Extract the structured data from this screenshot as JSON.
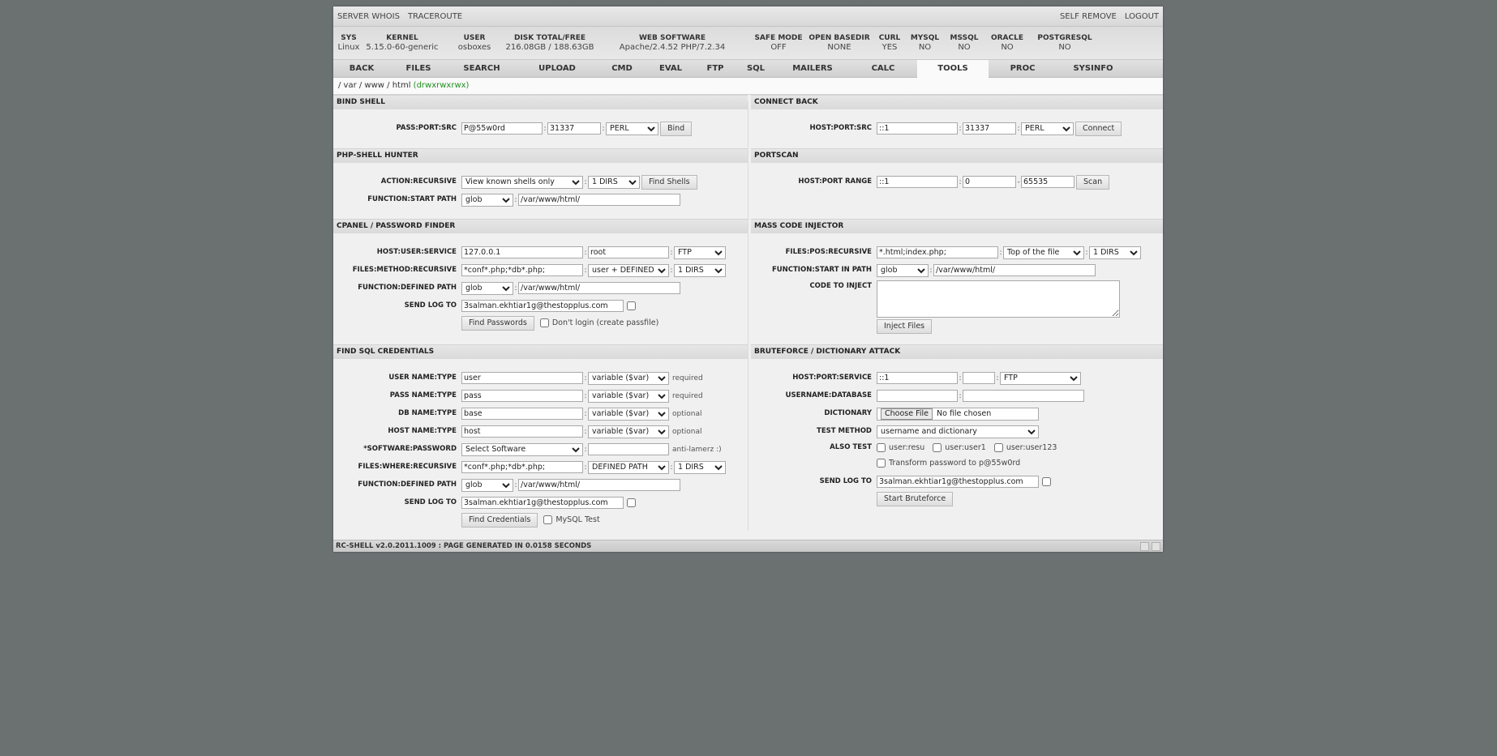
{
  "topbar": {
    "left": [
      "SERVER WHOIS",
      "TRACEROUTE"
    ],
    "right": [
      "SELF REMOVE",
      "LOGOUT"
    ]
  },
  "info": [
    {
      "h": "SYS",
      "v": "Linux"
    },
    {
      "h": "KERNEL",
      "v": "5.15.0-60-generic"
    },
    {
      "h": "USER",
      "v": "osboxes"
    },
    {
      "h": "DISK TOTAL/FREE",
      "v": "216.08GB / 188.63GB"
    },
    {
      "h": "WEB SOFTWARE",
      "v": "Apache/2.4.52 PHP/7.2.34"
    },
    {
      "h": "SAFE MODE",
      "v": "OFF"
    },
    {
      "h": "OPEN BASEDIR",
      "v": "NONE"
    },
    {
      "h": "CURL",
      "v": "YES"
    },
    {
      "h": "MYSQL",
      "v": "NO"
    },
    {
      "h": "MSSQL",
      "v": "NO"
    },
    {
      "h": "ORACLE",
      "v": "NO"
    },
    {
      "h": "POSTGRESQL",
      "v": "NO"
    }
  ],
  "tabs": [
    "BACK",
    "FILES",
    "SEARCH",
    "UPLOAD",
    "CMD",
    "EVAL",
    "FTP",
    "SQL",
    "MAILERS",
    "CALC",
    "TOOLS",
    "PROC",
    "SYSINFO"
  ],
  "active_tab": "TOOLS",
  "path": {
    "text": "/ var / www / html",
    "perm": "(drwxrwxrwx)"
  },
  "bind_shell": {
    "title": "BIND SHELL",
    "label": "PASS:PORT:SRC",
    "pass": "P@55w0rd",
    "port": "31337",
    "src": "PERL",
    "button": "Bind"
  },
  "connect_back": {
    "title": "CONNECT BACK",
    "label": "HOST:PORT:SRC",
    "host": "::1",
    "port": "31337",
    "src": "PERL",
    "button": "Connect"
  },
  "hunter": {
    "title": "PHP-SHELL HUNTER",
    "label1": "ACTION:RECURSIVE",
    "action": "View known shells only",
    "recursive": "1 DIRS",
    "button": "Find Shells",
    "label2": "FUNCTION:START PATH",
    "function": "glob",
    "path": "/var/www/html/"
  },
  "portscan": {
    "title": "PORTSCAN",
    "label": "HOST:PORT RANGE",
    "host": "::1",
    "from": "0",
    "to": "65535",
    "button": "Scan"
  },
  "cpanel": {
    "title": "CPANEL / PASSWORD FINDER",
    "label1": "HOST:USER:SERVICE",
    "host": "127.0.0.1",
    "user": "root",
    "service": "FTP",
    "label2": "FILES:METHOD:RECURSIVE",
    "files": "*conf*.php;*db*.php;",
    "method": "user + DEFINED",
    "recursive": "1 DIRS",
    "label3": "FUNCTION:DEFINED PATH",
    "function": "glob",
    "path": "/var/www/html/",
    "label4": "SEND LOG TO",
    "log": "3salman.ekhtiar1g@thestopplus.com",
    "button": "Find Passwords",
    "check": "Don't login (create passfile)"
  },
  "mass": {
    "title": "MASS CODE INJECTOR",
    "label1": "FILES:POS:RECURSIVE",
    "files": "*.html;index.php;",
    "pos": "Top of the file",
    "recursive": "1 DIRS",
    "label2": "FUNCTION:START IN PATH",
    "function": "glob",
    "path": "/var/www/html/",
    "label3": "CODE TO INJECT",
    "button": "Inject Files"
  },
  "sql": {
    "title": "FIND SQL CREDENTIALS",
    "rows": [
      {
        "label": "USER NAME:TYPE",
        "value": "user",
        "type": "variable ($var)",
        "note": "required"
      },
      {
        "label": "PASS NAME:TYPE",
        "value": "pass",
        "type": "variable ($var)",
        "note": "required"
      },
      {
        "label": "DB NAME:TYPE",
        "value": "base",
        "type": "variable ($var)",
        "note": "optional"
      },
      {
        "label": "HOST NAME:TYPE",
        "value": "host",
        "type": "variable ($var)",
        "note": "optional"
      }
    ],
    "label5": "*SOFTWARE:PASSWORD",
    "software": "Select Software",
    "password": "",
    "note5": "anti-lamerz :)",
    "label6": "FILES:WHERE:RECURSIVE",
    "files": "*conf*.php;*db*.php;",
    "where": "DEFINED PATH",
    "recursive": "1 DIRS",
    "label7": "FUNCTION:DEFINED PATH",
    "function": "glob",
    "path": "/var/www/html/",
    "label8": "SEND LOG TO",
    "log": "3salman.ekhtiar1g@thestopplus.com",
    "button": "Find Credentials",
    "check": "MySQL Test"
  },
  "brute": {
    "title": "BRUTEFORCE / DICTIONARY ATTACK",
    "label1": "HOST:PORT:SERVICE",
    "host": "::1",
    "port": "",
    "service": "FTP",
    "label2": "USERNAME:DATABASE",
    "username": "",
    "database": "",
    "label3": "DICTIONARY",
    "choose": "Choose File",
    "nofile": "No file chosen",
    "label4": "TEST METHOD",
    "method": "username and dictionary",
    "label5": "ALSO TEST",
    "also": [
      "user:resu",
      "user:user1",
      "user:user123"
    ],
    "transform": "Transform password to p@55w0rd",
    "label6": "SEND LOG TO",
    "log": "3salman.ekhtiar1g@thestopplus.com",
    "button": "Start Bruteforce"
  },
  "footer": "RC-SHELL v2.0.2011.1009 : PAGE GENERATED IN 0.0158 SECONDS"
}
